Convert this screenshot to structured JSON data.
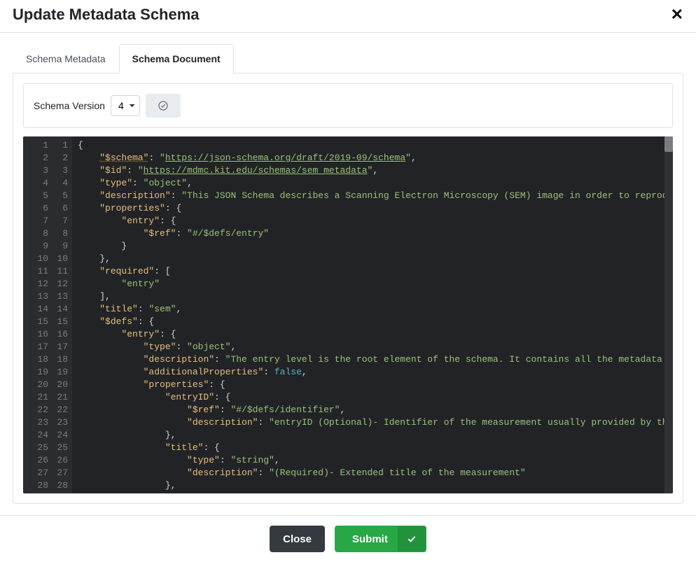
{
  "header": {
    "title": "Update Metadata Schema"
  },
  "tabs": {
    "metadata": "Schema Metadata",
    "document": "Schema Document"
  },
  "toolbar": {
    "version_label": "Schema Version",
    "version_value": "4"
  },
  "footer": {
    "close": "Close",
    "submit": "Submit"
  },
  "editor": {
    "line_count": 28,
    "lines": [
      [
        {
          "t": "{",
          "c": "p"
        }
      ],
      [
        {
          "t": "    ",
          "c": "p"
        },
        {
          "t": "\"$schema\"",
          "c": "u"
        },
        {
          "t": ": ",
          "c": "p"
        },
        {
          "t": "\"",
          "c": "s"
        },
        {
          "t": "https://json-schema.org/draft/2019-09/schema",
          "c": "lnk"
        },
        {
          "t": "\"",
          "c": "s"
        },
        {
          "t": ",",
          "c": "p"
        }
      ],
      [
        {
          "t": "    ",
          "c": "p"
        },
        {
          "t": "\"$id\"",
          "c": "k"
        },
        {
          "t": ": ",
          "c": "p"
        },
        {
          "t": "\"",
          "c": "s"
        },
        {
          "t": "https://mdmc.kit.edu/schemas/sem_metadata",
          "c": "lnk"
        },
        {
          "t": "\"",
          "c": "s"
        },
        {
          "t": ",",
          "c": "p"
        }
      ],
      [
        {
          "t": "    ",
          "c": "p"
        },
        {
          "t": "\"type\"",
          "c": "k"
        },
        {
          "t": ": ",
          "c": "p"
        },
        {
          "t": "\"object\"",
          "c": "s"
        },
        {
          "t": ",",
          "c": "p"
        }
      ],
      [
        {
          "t": "    ",
          "c": "p"
        },
        {
          "t": "\"description\"",
          "c": "k"
        },
        {
          "t": ": ",
          "c": "p"
        },
        {
          "t": "\"This JSON Schema describes a Scanning Electron Microscopy (SEM) image in order to reproduce the me",
          "c": "s"
        }
      ],
      [
        {
          "t": "    ",
          "c": "p"
        },
        {
          "t": "\"properties\"",
          "c": "k"
        },
        {
          "t": ": {",
          "c": "p"
        }
      ],
      [
        {
          "t": "        ",
          "c": "p"
        },
        {
          "t": "\"entry\"",
          "c": "k"
        },
        {
          "t": ": {",
          "c": "p"
        }
      ],
      [
        {
          "t": "            ",
          "c": "p"
        },
        {
          "t": "\"$ref\"",
          "c": "k"
        },
        {
          "t": ": ",
          "c": "p"
        },
        {
          "t": "\"#/$defs/entry\"",
          "c": "s"
        }
      ],
      [
        {
          "t": "        }",
          "c": "p"
        }
      ],
      [
        {
          "t": "    },",
          "c": "p"
        }
      ],
      [
        {
          "t": "    ",
          "c": "p"
        },
        {
          "t": "\"required\"",
          "c": "k"
        },
        {
          "t": ": [",
          "c": "p"
        }
      ],
      [
        {
          "t": "        ",
          "c": "p"
        },
        {
          "t": "\"entry\"",
          "c": "s"
        }
      ],
      [
        {
          "t": "    ],",
          "c": "p"
        }
      ],
      [
        {
          "t": "    ",
          "c": "p"
        },
        {
          "t": "\"title\"",
          "c": "k"
        },
        {
          "t": ": ",
          "c": "p"
        },
        {
          "t": "\"sem\"",
          "c": "s"
        },
        {
          "t": ",",
          "c": "p"
        }
      ],
      [
        {
          "t": "    ",
          "c": "p"
        },
        {
          "t": "\"$defs\"",
          "c": "k"
        },
        {
          "t": ": {",
          "c": "p"
        }
      ],
      [
        {
          "t": "        ",
          "c": "p"
        },
        {
          "t": "\"entry\"",
          "c": "k"
        },
        {
          "t": ": {",
          "c": "p"
        }
      ],
      [
        {
          "t": "            ",
          "c": "p"
        },
        {
          "t": "\"type\"",
          "c": "k"
        },
        {
          "t": ": ",
          "c": "p"
        },
        {
          "t": "\"object\"",
          "c": "s"
        },
        {
          "t": ",",
          "c": "p"
        }
      ],
      [
        {
          "t": "            ",
          "c": "p"
        },
        {
          "t": "\"description\"",
          "c": "k"
        },
        {
          "t": ": ",
          "c": "p"
        },
        {
          "t": "\"The entry level is the root element of the schema. It contains all the metadata describing",
          "c": "s"
        }
      ],
      [
        {
          "t": "            ",
          "c": "p"
        },
        {
          "t": "\"additionalProperties\"",
          "c": "k"
        },
        {
          "t": ": ",
          "c": "p"
        },
        {
          "t": "false",
          "c": "c"
        },
        {
          "t": ",",
          "c": "p"
        }
      ],
      [
        {
          "t": "            ",
          "c": "p"
        },
        {
          "t": "\"properties\"",
          "c": "k"
        },
        {
          "t": ": {",
          "c": "p"
        }
      ],
      [
        {
          "t": "                ",
          "c": "p"
        },
        {
          "t": "\"entryID\"",
          "c": "k"
        },
        {
          "t": ": {",
          "c": "p"
        }
      ],
      [
        {
          "t": "                    ",
          "c": "p"
        },
        {
          "t": "\"$ref\"",
          "c": "k"
        },
        {
          "t": ": ",
          "c": "p"
        },
        {
          "t": "\"#/$defs/identifier\"",
          "c": "s"
        },
        {
          "t": ",",
          "c": "p"
        }
      ],
      [
        {
          "t": "                    ",
          "c": "p"
        },
        {
          "t": "\"description\"",
          "c": "k"
        },
        {
          "t": ": ",
          "c": "p"
        },
        {
          "t": "\"entryID (Optional)- Identifier of the measurement usually provided by the project",
          "c": "s"
        }
      ],
      [
        {
          "t": "                },",
          "c": "p"
        }
      ],
      [
        {
          "t": "                ",
          "c": "p"
        },
        {
          "t": "\"title\"",
          "c": "k"
        },
        {
          "t": ": {",
          "c": "p"
        }
      ],
      [
        {
          "t": "                    ",
          "c": "p"
        },
        {
          "t": "\"type\"",
          "c": "k"
        },
        {
          "t": ": ",
          "c": "p"
        },
        {
          "t": "\"string\"",
          "c": "s"
        },
        {
          "t": ",",
          "c": "p"
        }
      ],
      [
        {
          "t": "                    ",
          "c": "p"
        },
        {
          "t": "\"description\"",
          "c": "k"
        },
        {
          "t": ": ",
          "c": "p"
        },
        {
          "t": "\"(Required)- Extended title of the measurement\"",
          "c": "s"
        }
      ],
      [
        {
          "t": "                },",
          "c": "p"
        }
      ]
    ]
  }
}
